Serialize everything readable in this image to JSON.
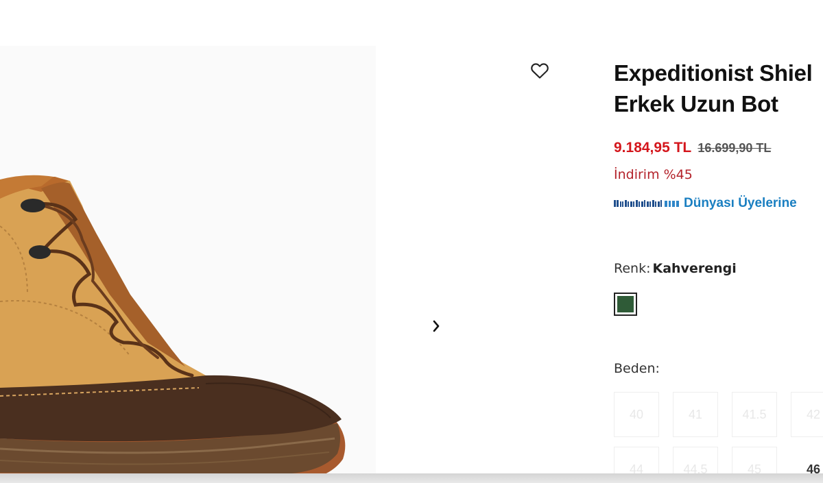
{
  "product": {
    "title_line1": "Expeditionist Shiel",
    "title_line2": "Erkek Uzun Bot",
    "price": "9.184,95 TL",
    "old_price": "16.699,90 TL",
    "discount": "İndirim %45",
    "member_text": "Dünyası Üyelerine",
    "color_label": "Renk:",
    "color_value": "Kahverengi",
    "size_label": "Beden:",
    "sizes_row1": [
      "40",
      "41",
      "41.5",
      "42"
    ],
    "sizes_row2": [
      "44",
      "44.5",
      "45",
      "46"
    ]
  },
  "colors": {
    "price": "#d4161c",
    "discount": "#b3222a",
    "member_link": "#1a7fc1",
    "swatch": "#2f5b37"
  },
  "icons": {
    "favorite": "heart-outline-icon",
    "next": "chevron-right-icon"
  }
}
